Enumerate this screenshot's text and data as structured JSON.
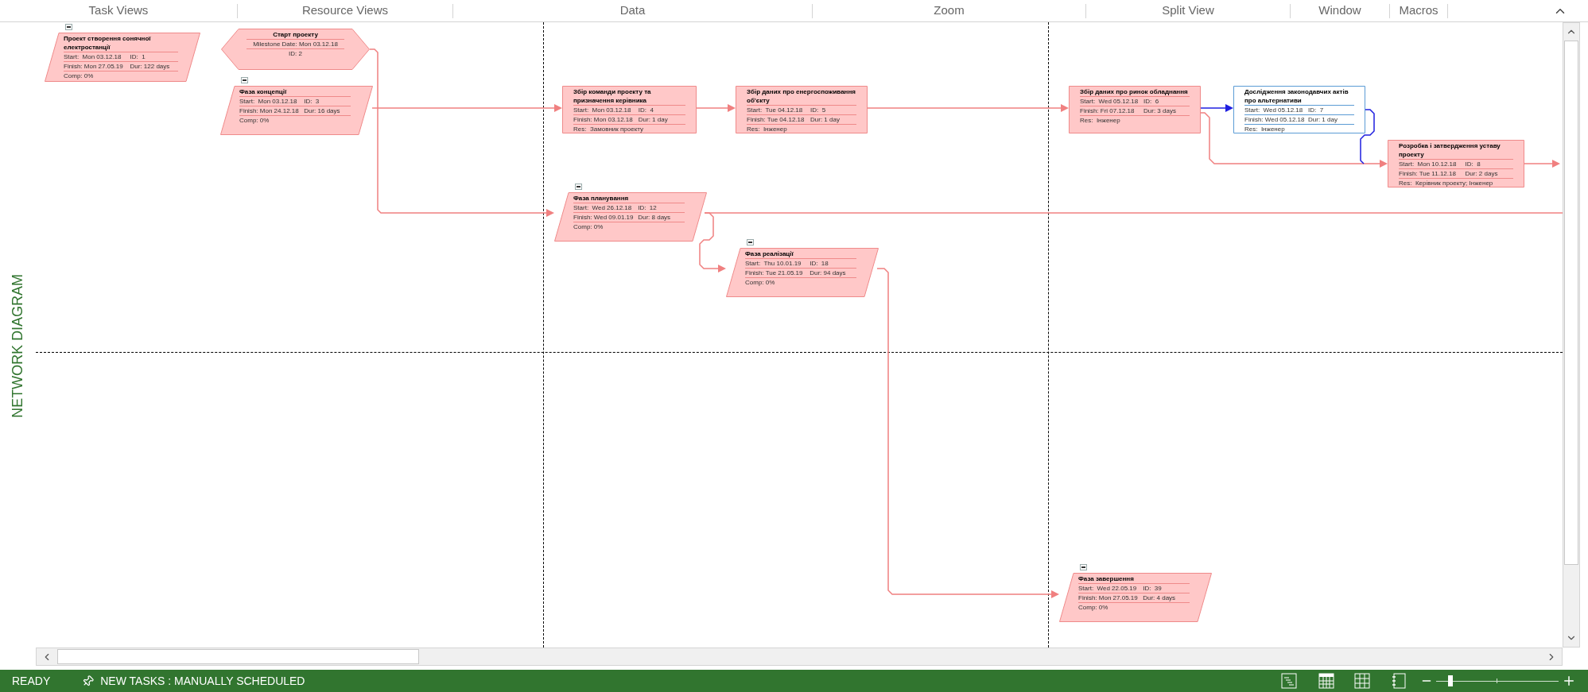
{
  "ribbon_groups": [
    "Task Views",
    "Resource Views",
    "Data",
    "Zoom",
    "Split View",
    "Window",
    "Macros"
  ],
  "view_label": "NETWORK DIAGRAM",
  "nodes": [
    {
      "kind": "summary",
      "selected": false,
      "expanded": true,
      "title": "Проект створення сонячної електростанції",
      "rows": [
        [
          "Start:  Mon 03.12.18",
          "ID:  1"
        ],
        [
          "Finish: Mon 27.05.19",
          "Dur: 122 days"
        ],
        [
          "Comp: 0%"
        ]
      ]
    },
    {
      "kind": "milestone",
      "selected": false,
      "title": "Старт проекту",
      "rows": [
        [
          "Milestone Date: Mon 03.12.18"
        ],
        [
          "ID: 2"
        ]
      ]
    },
    {
      "kind": "summary",
      "selected": false,
      "expanded": true,
      "title": "Фаза концепції",
      "rows": [
        [
          "Start:  Mon 03.12.18",
          "ID:  3"
        ],
        [
          "Finish: Mon 24.12.18",
          "Dur: 16 days"
        ],
        [
          "Comp: 0%"
        ]
      ]
    },
    {
      "kind": "task",
      "selected": false,
      "title": "Збір команди проекту та призначення керівника",
      "rows": [
        [
          "Start:  Mon 03.12.18",
          "ID:  4"
        ],
        [
          "Finish: Mon 03.12.18",
          "Dur: 1 day"
        ],
        [
          "Res:  Замовник проекту"
        ]
      ]
    },
    {
      "kind": "task",
      "selected": false,
      "title": "Збір даних про енергоспоживання об'єкту",
      "rows": [
        [
          "Start:  Tue 04.12.18",
          "ID:  5"
        ],
        [
          "Finish: Tue 04.12.18",
          "Dur: 1 day"
        ],
        [
          "Res:  Інженер"
        ]
      ]
    },
    {
      "kind": "task",
      "selected": false,
      "title": "Збір даних про ринок обладнання",
      "rows": [
        [
          "Start:  Wed 05.12.18",
          "ID:  6"
        ],
        [
          "Finish: Fri 07.12.18",
          "Dur: 3 days"
        ],
        [
          "Res:  Інженер"
        ]
      ]
    },
    {
      "kind": "task",
      "selected": true,
      "title": "Дослідження законодавчих актів про альтернативи",
      "rows": [
        [
          "Start:  Wed 05.12.18",
          "ID:  7"
        ],
        [
          "Finish: Wed 05.12.18",
          "Dur: 1 day"
        ],
        [
          "Res:  Інженер"
        ]
      ]
    },
    {
      "kind": "task",
      "selected": false,
      "title": "Розробка і затвердження уставу проекту",
      "rows": [
        [
          "Start:  Mon 10.12.18",
          "ID:  8"
        ],
        [
          "Finish: Tue 11.12.18",
          "Dur: 2 days"
        ],
        [
          "Res:  Керівник проекту; Інженер"
        ]
      ]
    },
    {
      "kind": "summary",
      "selected": false,
      "expanded": true,
      "title": "Фаза планування",
      "rows": [
        [
          "Start:  Wed 26.12.18",
          "ID:  12"
        ],
        [
          "Finish: Wed 09.01.19",
          "Dur: 8 days"
        ],
        [
          "Comp: 0%"
        ]
      ]
    },
    {
      "kind": "summary",
      "selected": false,
      "expanded": true,
      "title": "Фаза реалізації",
      "rows": [
        [
          "Start:  Thu 10.01.19",
          "ID:  18"
        ],
        [
          "Finish: Tue 21.05.19",
          "Dur: 94 days"
        ],
        [
          "Comp: 0%"
        ]
      ]
    },
    {
      "kind": "summary",
      "selected": false,
      "expanded": true,
      "title": "Фаза завершення",
      "rows": [
        [
          "Start:  Wed 22.05.19",
          "ID:  39"
        ],
        [
          "Finish: Mon 27.05.19",
          "Dur: 4 days"
        ],
        [
          "Comp: 0%"
        ]
      ]
    }
  ],
  "status_bar": {
    "mode": "READY",
    "new_tasks": "NEW TASKS : MANUALLY SCHEDULED",
    "zoom": {
      "level": 0.12
    }
  }
}
